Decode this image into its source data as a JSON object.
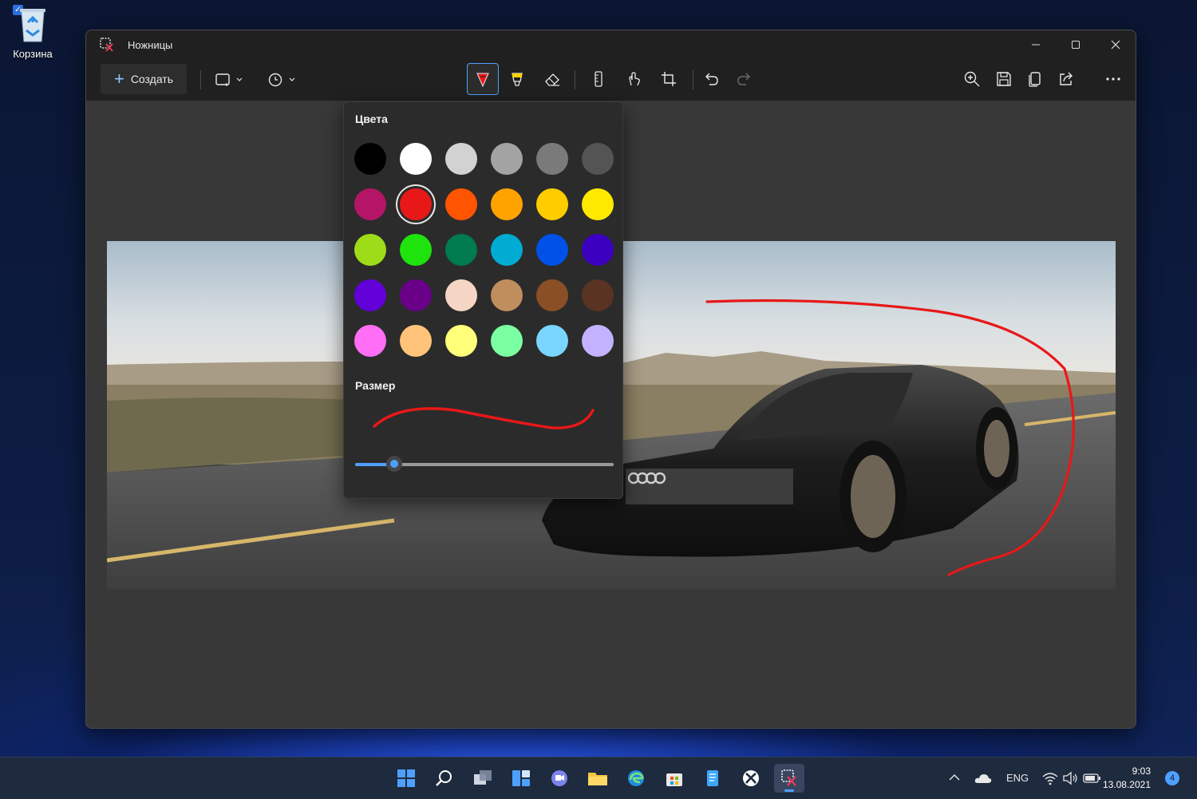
{
  "desktop": {
    "recycle_bin_label": "Корзина"
  },
  "window": {
    "title": "Ножницы",
    "controls": [
      "minimize",
      "maximize",
      "close"
    ]
  },
  "toolbar": {
    "new_label": "Создать",
    "icons": [
      "snip-mode-icon",
      "delay-icon",
      "ballpoint-pen-icon",
      "highlighter-icon",
      "eraser-icon",
      "ruler-icon",
      "touch-writing-icon",
      "crop-icon",
      "undo-icon",
      "redo-icon",
      "zoom-in-icon",
      "save-icon",
      "copy-icon",
      "share-icon",
      "more-icon"
    ],
    "accent_color": "#4ea0ff"
  },
  "flyout": {
    "colors_heading": "Цвета",
    "size_heading": "Размер",
    "selected_color": "#e81818",
    "size_fraction": 0.15,
    "palette": [
      [
        "#000000",
        "#ffffff",
        "#d2d2d2",
        "#a3a3a3",
        "#7a7a7a",
        "#545454"
      ],
      [
        "#b41567",
        "#e81818",
        "#ff5400",
        "#ffa300",
        "#ffcc00",
        "#ffe900"
      ],
      [
        "#9edc1a",
        "#1ee30c",
        "#007a4f",
        "#00acd2",
        "#0051e8",
        "#3c00c0"
      ],
      [
        "#6200d8",
        "#6a0088",
        "#f5d6c4",
        "#c08e5d",
        "#8b4f25",
        "#5a3323"
      ],
      [
        "#ff6ef5",
        "#ffc47a",
        "#ffff7a",
        "#7affa2",
        "#7ad6ff",
        "#c2b2ff"
      ]
    ]
  },
  "annotation": {
    "stroke_color": "#e81818"
  },
  "taskbar": {
    "apps": [
      "start-icon",
      "search-icon",
      "task-view-icon",
      "widgets-icon",
      "teams-chat-icon",
      "file-explorer-icon",
      "edge-icon",
      "store-icon",
      "notepad-icon",
      "xbox-icon",
      "snipping-tool-icon"
    ],
    "active_app": "snipping-tool-icon",
    "language": "ENG",
    "time": "9:03",
    "date": "13.08.2021",
    "notification_count": "4"
  }
}
